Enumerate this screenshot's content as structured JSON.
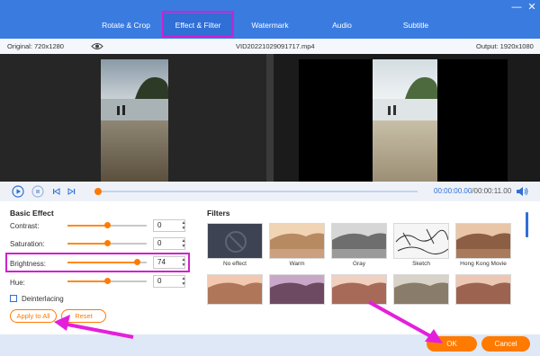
{
  "tabs": [
    {
      "label": "Rotate & Crop"
    },
    {
      "label": "Effect & Filter",
      "active": true
    },
    {
      "label": "Watermark"
    },
    {
      "label": "Audio"
    },
    {
      "label": "Subtitle"
    }
  ],
  "info": {
    "original": "Original: 720x1280",
    "filename": "VID20221029091717.mp4",
    "output": "Output: 1920x1080"
  },
  "playback": {
    "current": "00:00:00.00",
    "total": "/00:00:11.00",
    "progress": 0.0
  },
  "basic_effect": {
    "title": "Basic Effect",
    "rows": [
      {
        "label": "Contrast:",
        "value": "0",
        "level": 0.5
      },
      {
        "label": "Saturation:",
        "value": "0",
        "level": 0.5
      },
      {
        "label": "Brightness:",
        "value": "74",
        "level": 0.87
      },
      {
        "label": "Hue:",
        "value": "0",
        "level": 0.5
      }
    ],
    "deinterlacing": "Deinterlacing",
    "apply_all": "Apply to All",
    "reset": "Reset"
  },
  "filters": {
    "title": "Filters",
    "items": [
      {
        "label": "No effect"
      },
      {
        "label": "Warm"
      },
      {
        "label": "Gray"
      },
      {
        "label": "Sketch"
      },
      {
        "label": "Hong Kong Movie"
      }
    ]
  },
  "footer": {
    "ok": "OK",
    "cancel": "Cancel"
  },
  "colors": {
    "accent": "#ff7a00",
    "tabbar": "#3a7be0",
    "highlight": "#d21fd1"
  }
}
